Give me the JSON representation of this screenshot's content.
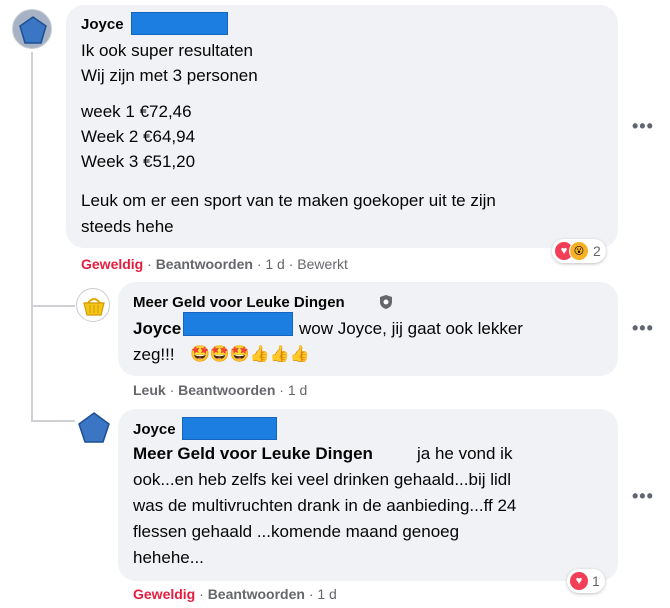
{
  "comment1": {
    "author": "Joyce",
    "lines": [
      "Ik ook super resultaten",
      "Wij zijn met 3 personen",
      "week 1 €72,46",
      "Week 2 €64,94",
      "Week 3 €51,20",
      "Leuk om er een sport van te maken goekoper uit te zijn",
      "steeds hehe"
    ],
    "reaction": "Geweldig",
    "reply": "Beantwoorden",
    "time": "1 d",
    "edited": "Bewerkt",
    "reaction_count": "2"
  },
  "comment2": {
    "author": "Meer Geld voor Leuke Dingen",
    "mention": "Joyce",
    "text_line1": "wow Joyce, jij gaat ook lekker",
    "text_line2": "zeg!!!",
    "emojis": "🤩🤩🤩👍👍👍",
    "reaction": "Leuk",
    "reply": "Beantwoorden",
    "time": "1 d"
  },
  "comment3": {
    "author": "Joyce",
    "mention": "Meer Geld voor Leuke Dingen",
    "line1": "ja he vond ik",
    "line2": "ook...en heb zelfs kei veel drinken gehaald...bij lidl",
    "line3": "was de multivruchten drank in de aanbieding...ff 24",
    "line4": "flessen gehaald ...komende maand genoeg",
    "line5": "hehehe...",
    "reaction": "Geweldig",
    "reply": "Beantwoorden",
    "time": "1 d",
    "reaction_count": "1"
  },
  "more_options": "•••",
  "dot": "·",
  "colors": {
    "bubble": "#f0f2f5",
    "love_red": "#e41e3f",
    "redaction": "#1d7ee2",
    "meta": "#65676b"
  },
  "icons": [
    "avatar-pentagon-icon",
    "basket-logo-icon",
    "verified-badge-icon",
    "heart-react-icon",
    "wow-react-icon",
    "more-options-icon"
  ]
}
